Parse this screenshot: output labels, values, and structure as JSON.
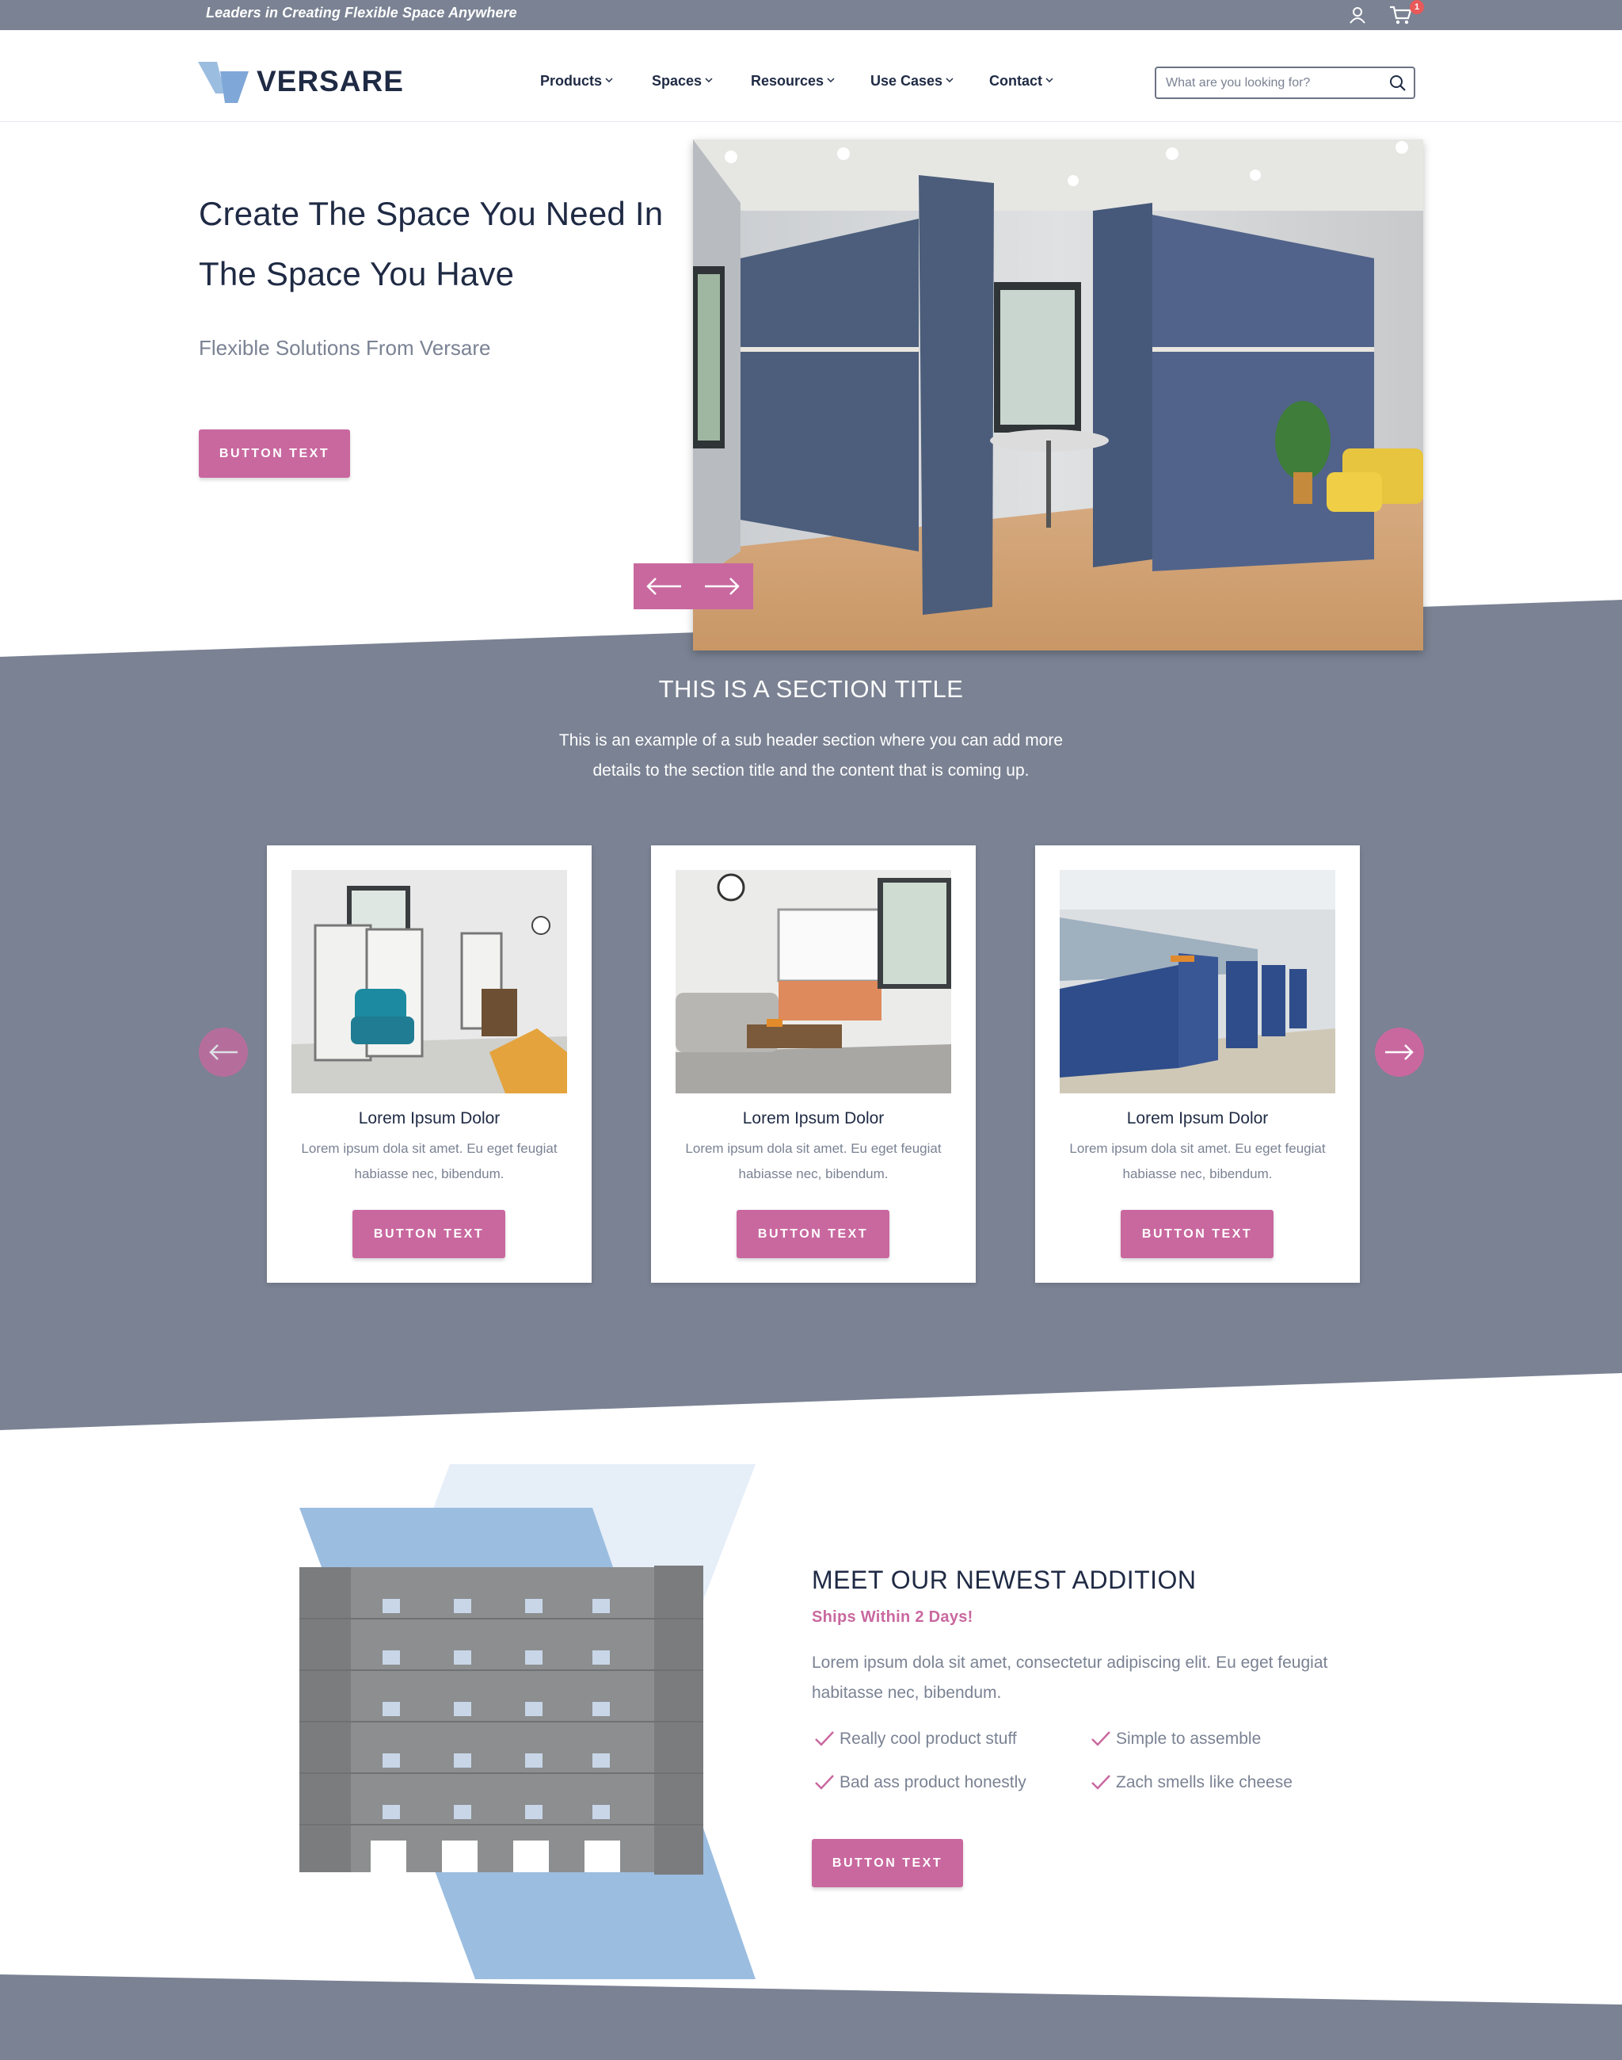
{
  "topbar": {
    "tagline": "Leaders in Creating Flexible Space Anywhere",
    "account_icon": "user-icon",
    "cart_icon": "cart-icon",
    "cart_count": "1"
  },
  "header": {
    "logo_text": "VERSARE",
    "nav": [
      {
        "label": "Products"
      },
      {
        "label": "Spaces"
      },
      {
        "label": "Resources"
      },
      {
        "label": "Use Cases"
      },
      {
        "label": "Contact"
      }
    ],
    "search_placeholder": "What are you looking for?"
  },
  "hero": {
    "title": "Create The Space You Need In The Space You Have",
    "subtitle": "Flexible Solutions From Versare",
    "button": "BUTTON TEXT"
  },
  "section": {
    "title": "THIS IS A SECTION TITLE",
    "subtitle": "This is an example of a sub header section where you can add more details to the section title and the content that is coming up.",
    "cards": [
      {
        "title": "Lorem Ipsum Dolor",
        "text": "Lorem ipsum dola sit amet. Eu eget feugiat habiasse nec, bibendum.",
        "button": "BUTTON TEXT"
      },
      {
        "title": "Lorem Ipsum Dolor",
        "text": "Lorem ipsum dola sit amet. Eu eget feugiat habiasse nec, bibendum.",
        "button": "BUTTON TEXT"
      },
      {
        "title": "Lorem Ipsum Dolor",
        "text": "Lorem ipsum dola sit amet. Eu eget feugiat habiasse nec, bibendum.",
        "button": "BUTTON TEXT"
      }
    ]
  },
  "newest": {
    "title": "MEET OUR NEWEST ADDITION",
    "subtitle": "Ships Within 2 Days!",
    "text": "Lorem ipsum dola sit amet, consectetur adipiscing elit. Eu eget feugiat habitasse nec, bibendum.",
    "features": [
      "Really cool product stuff",
      "Simple to assemble",
      "Bad ass product honestly",
      "Zach smells like cheese"
    ],
    "button": "BUTTON TEXT"
  },
  "colors": {
    "accent": "#c9689f",
    "slate": "#7a8293",
    "navy": "#1f2a44",
    "light_blue": "#9bbde0"
  }
}
